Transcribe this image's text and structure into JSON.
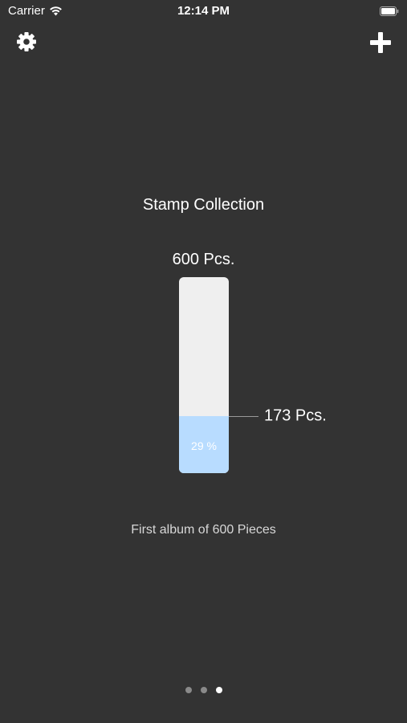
{
  "status_bar": {
    "carrier": "Carrier",
    "time": "12:14 PM"
  },
  "nav": {
    "left_icon": "gear-icon",
    "right_icon": "plus-icon"
  },
  "collection": {
    "title": "Stamp Collection",
    "capacity_label": "600 Pcs.",
    "count_label": "173 Pcs.",
    "percent_label": "29 %",
    "fill_fraction": 0.29,
    "description": "First album of 600 Pieces"
  },
  "colors": {
    "background": "#333333",
    "gauge_track": "#efefef",
    "gauge_fill": "#b8dcff"
  },
  "pager": {
    "pages": 3,
    "current": 3
  }
}
